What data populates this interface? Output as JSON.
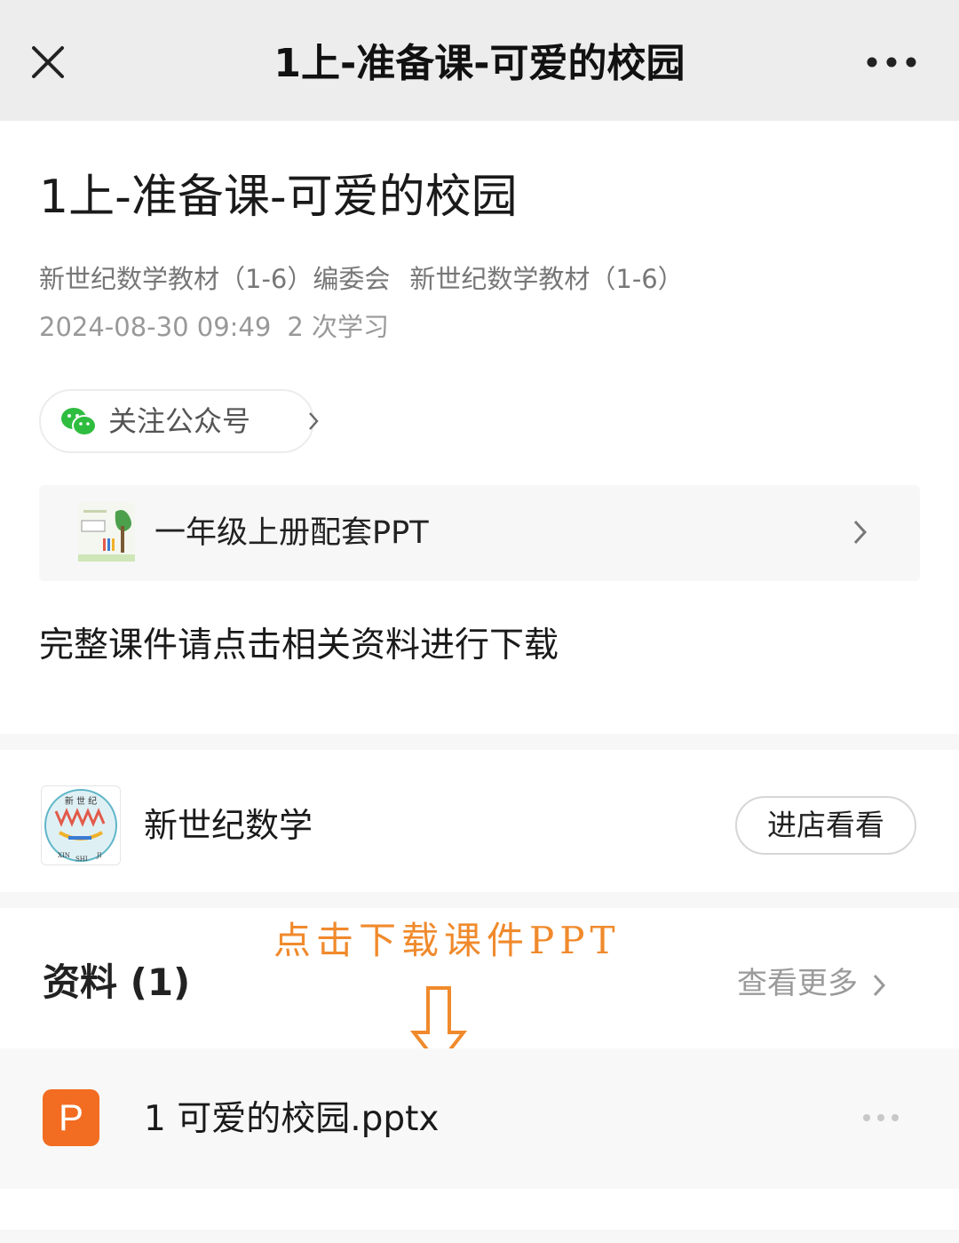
{
  "header": {
    "title": "1上-准备课-可爱的校园",
    "close_icon": "close-icon",
    "more_icon": "more-icon"
  },
  "article": {
    "title": "1上-准备课-可爱的校园",
    "authors": [
      "新世纪数学教材（1-6）编委会",
      "新世纪数学教材（1-6）"
    ],
    "date": "2024-08-30 09:49",
    "views": "2 次学习",
    "follow_label": "关注公众号",
    "collection_label": "一年级上册配套PPT",
    "body_text": "完整课件请点击相关资料进行下载"
  },
  "shop": {
    "name": "新世纪数学",
    "button_label": "进店看看"
  },
  "annotation": {
    "text": "点击下载课件PPT",
    "color": "#f08a2c"
  },
  "resources": {
    "title": "资料 (1)",
    "more_label": "查看更多",
    "files": [
      {
        "icon_letter": "P",
        "name": "1 可爱的校园.pptx",
        "icon_color": "#f26c21"
      }
    ]
  },
  "logo_text": {
    "top": "新 世 纪",
    "bottom": [
      "XIN",
      "SHI",
      "JI"
    ]
  }
}
